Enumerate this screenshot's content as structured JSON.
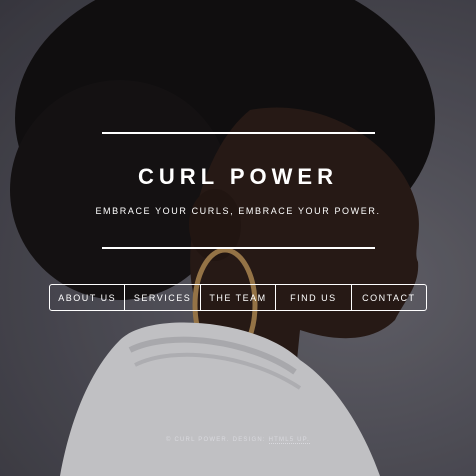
{
  "site": {
    "title": "CURL POWER",
    "tagline": "EMBRACE YOUR CURLS, EMBRACE YOUR POWER."
  },
  "nav": {
    "items": [
      {
        "label": "ABOUT US"
      },
      {
        "label": "SERVICES"
      },
      {
        "label": "THE TEAM"
      },
      {
        "label": "FIND US"
      },
      {
        "label": "CONTACT"
      }
    ]
  },
  "footer": {
    "copyright": "© CURL POWER. DESIGN: ",
    "credit": "HTML5 UP."
  },
  "colors": {
    "text": "#ffffff",
    "background": "#5a5962"
  }
}
